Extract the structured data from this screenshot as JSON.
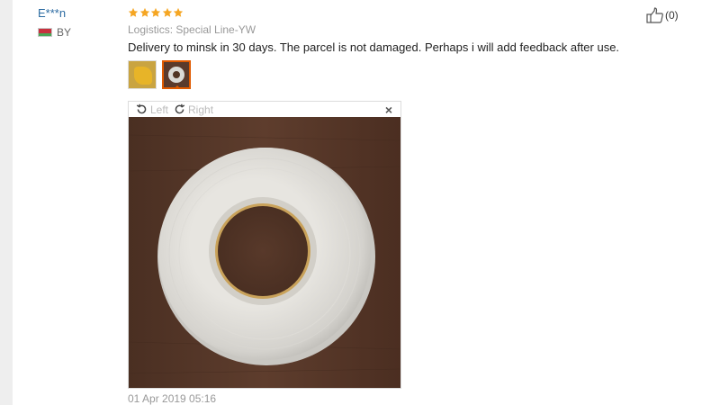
{
  "user": {
    "name": "E***n",
    "country": "BY"
  },
  "review": {
    "rating": 5,
    "logistics": "Logistics: Special Line-YW",
    "text": "Delivery to minsk in 30 days. The parcel is not damaged. Perhaps i will add feedback after use.",
    "date": "01 Apr 2019 05:16"
  },
  "helpful": {
    "count_label": "(0)"
  },
  "viewer": {
    "rotate_left_label": "Left",
    "rotate_right_label": "Right",
    "close_label": "×"
  },
  "icons": {
    "star": "star-icon",
    "thumbs_up": "thumbs-up-icon",
    "rotate_left": "rotate-left-icon",
    "rotate_right": "rotate-right-icon",
    "close": "close-icon",
    "flag": "belarus-flag-icon"
  },
  "colors": {
    "star": "#f5a623",
    "username": "#2d6ca2",
    "selected_border": "#e05a00"
  }
}
